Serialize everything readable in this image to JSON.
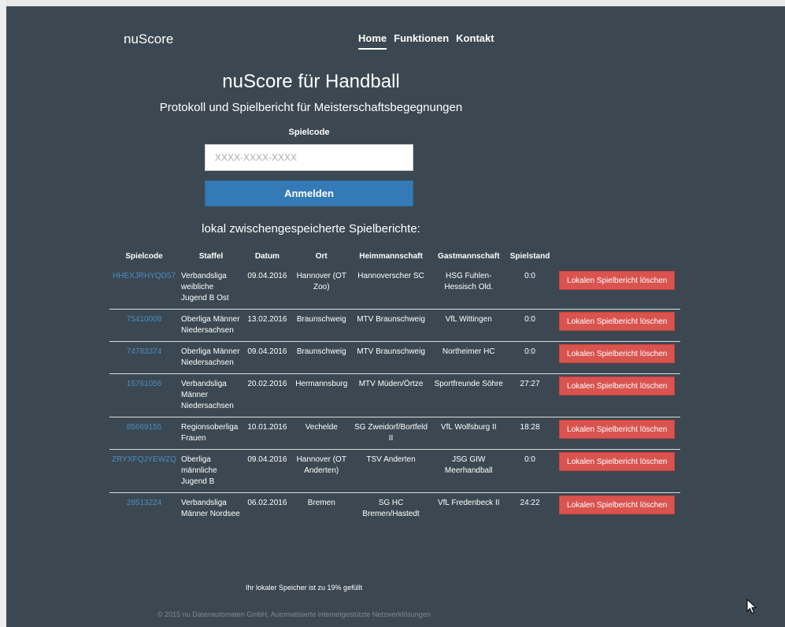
{
  "app": {
    "brand": "nuScore"
  },
  "nav": [
    {
      "label": "Home",
      "active": true
    },
    {
      "label": "Funktionen",
      "active": false
    },
    {
      "label": "Kontakt",
      "active": false
    }
  ],
  "hero": {
    "title": "nuScore für Handball",
    "subtitle": "Protokoll und Spielbericht für Meisterschaftsbegegnungen"
  },
  "login": {
    "code_label": "Spielcode",
    "code_placeholder": "XXXX-XXXX-XXXX",
    "code_value": "",
    "submit_label": "Anmelden"
  },
  "saved": {
    "heading": "lokal zwischengespeicherte Spielberichte:",
    "columns": [
      "Spielcode",
      "Staffel",
      "Datum",
      "Ort",
      "Heimmannschaft",
      "Gastmannschaft",
      "Spielstand"
    ],
    "delete_label": "Lokalen Spielbericht löschen",
    "rows": [
      {
        "code": "HHEXJRHYQD57",
        "staffel": "Verbandsliga weibliche Jugend B Ost",
        "datum": "09.04.2016",
        "ort": "Hannover (OT Zoo)",
        "heim": "Hannoverscher SC",
        "gast": "HSG Fuhlen-Hessisch Old.",
        "stand": "0:0"
      },
      {
        "code": "75410008",
        "staffel": "Oberliga Männer Niedersachsen",
        "datum": "13.02.2016",
        "ort": "Braunschweig",
        "heim": "MTV Braunschweig",
        "gast": "VfL Wittingen",
        "stand": "0:0"
      },
      {
        "code": "74783374",
        "staffel": "Oberliga Männer Niedersachsen",
        "datum": "09.04.2016",
        "ort": "Braunschweig",
        "heim": "MTV Braunschweig",
        "gast": "Northeimer HC",
        "stand": "0:0"
      },
      {
        "code": "15761056",
        "staffel": "Verbandsliga Männer Niedersachsen",
        "datum": "20.02.2016",
        "ort": "Hermannsburg",
        "heim": "MTV Müden/Örtze",
        "gast": "Sportfreunde Söhre",
        "stand": "27:27"
      },
      {
        "code": "85669155",
        "staffel": "Regionsoberliga Frauen",
        "datum": "10.01.2016",
        "ort": "Vechelde",
        "heim": "SG Zweidorf/Bortfeld II",
        "gast": "VfL Wolfsburg II",
        "stand": "18:28"
      },
      {
        "code": "ZRYXFQJYEWZQ",
        "staffel": "Oberliga männliche Jugend B",
        "datum": "09.04.2016",
        "ort": "Hannover (OT Anderten)",
        "heim": "TSV Anderten",
        "gast": "JSG GIW Meerhandball",
        "stand": "0:0"
      },
      {
        "code": "28513224",
        "staffel": "Verbandsliga Männer Nordsee",
        "datum": "06.02.2016",
        "ort": "Bremen",
        "heim": "SG HC Bremen/Hastedt",
        "gast": "VfL Fredenbeck II",
        "stand": "24:22"
      }
    ]
  },
  "storage": {
    "text": "Ihr lokaler Speicher ist zu 19% gefüllt",
    "percent_used": 19
  },
  "footer": {
    "text": "© 2015 nu Datenautomaten GmbH, Automatisierte internetgestützte Netzwerklösungen"
  },
  "colors": {
    "background": "#3b4851",
    "primary": "#337ab7",
    "danger": "#d9534f",
    "link": "#4b8cc5"
  }
}
